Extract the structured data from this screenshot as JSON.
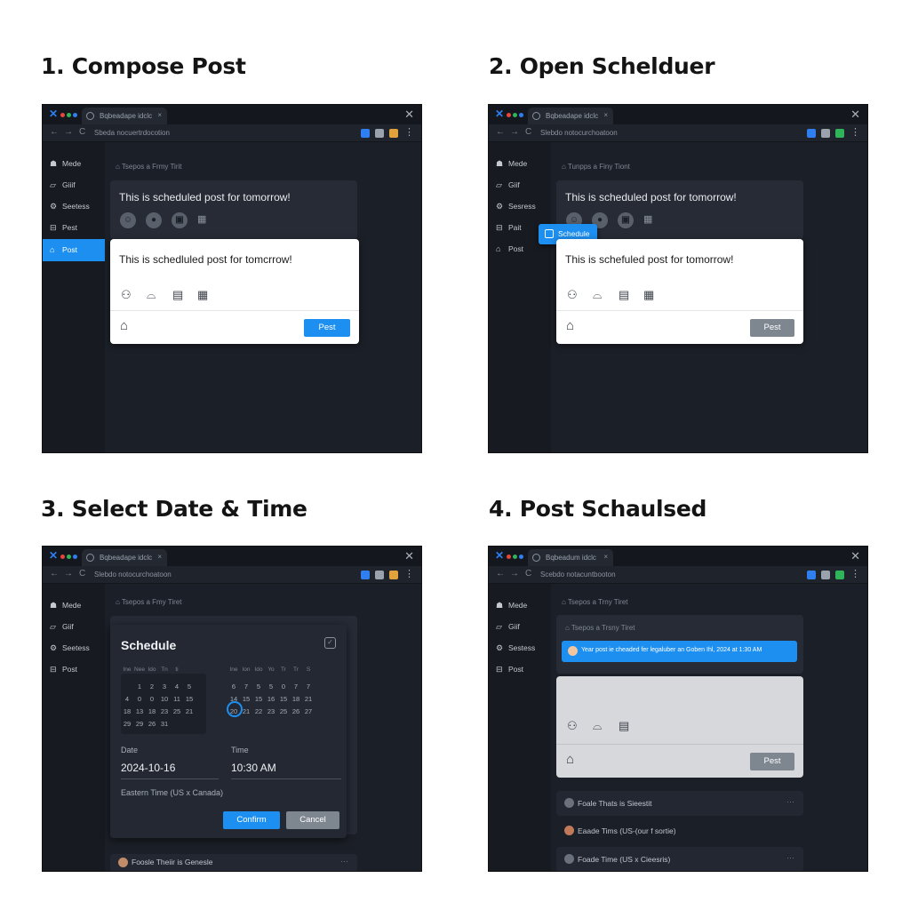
{
  "steps": [
    {
      "title": "1. Compose Post"
    },
    {
      "title": "2. Open Schelduer"
    },
    {
      "title": "3. Select Date & Time"
    },
    {
      "title": "4. Post Schaulsed"
    }
  ],
  "browser": {
    "tab_titles": [
      "Bqbeadape idclc",
      "Bqbeadape idclc",
      "Bqbeadape idclc",
      "Bqbeadum idclc"
    ],
    "url": "Sbeda nocuertrdocotion",
    "url_alt": "Slebdo notocurchoatoon",
    "url_4": "Scebdo notacuntbooton",
    "colors": {
      "accent": "#1d8ff0",
      "dot_red": "#e8453c",
      "dot_green": "#2fb45a",
      "dot_blue": "#2f7ff0"
    }
  },
  "sidebar": {
    "items": [
      {
        "label": "Mede",
        "icon": "home-icon"
      },
      {
        "label": "Giiif",
        "icon": "image-icon"
      },
      {
        "label": "Seetess",
        "icon": "settings-icon"
      },
      {
        "label": "Pest",
        "icon": "lock-icon"
      },
      {
        "label": "Post",
        "icon": "post-icon"
      }
    ],
    "items_2": [
      "Mede",
      "Giif",
      "Sesress",
      "Pait",
      "Post"
    ],
    "items_3": [
      "Mede",
      "Giif",
      "Seetess",
      "Post"
    ],
    "items_4": [
      "Mede",
      "Giif",
      "Sestess",
      "Post"
    ]
  },
  "breadcrumb": "Tsepos a Frmy Tirit",
  "breadcrumb_2": "Tunpps a Finy Tiont",
  "breadcrumb_3": "Tsepos a Fmy Tiret",
  "breadcrumb_4": "Tsepos a Trny Tiret",
  "composer": {
    "text_preview": "This is scheduled post for tomorrow!",
    "text_1": "This is schedluled post for tomcrrow!",
    "text_2": "This is schefuled post for tomorrow!",
    "post_label": "Pest",
    "post_label_disabled": "Pest"
  },
  "schedule_tip": "Schedule",
  "dialog": {
    "title": "Schedule",
    "left_calendar": {
      "header": [
        "Ine",
        "Nee",
        "Ido",
        "Tn",
        "ti"
      ],
      "rows": [
        [
          "",
          "1",
          "2",
          "3",
          "4",
          "5"
        ],
        [
          "4",
          "0",
          "0",
          "10",
          "11",
          "15"
        ],
        [
          "18",
          "13",
          "18",
          "23",
          "25",
          "21"
        ],
        [
          "29",
          "29",
          "26",
          "31",
          "",
          ""
        ]
      ]
    },
    "right_calendar": {
      "header": [
        "Ine",
        "Ion",
        "Ido",
        "Yo",
        "Tr",
        "Tr",
        "S"
      ],
      "rows": [
        [
          "6",
          "7",
          "5",
          "5",
          "0",
          "7",
          "7"
        ],
        [
          "14",
          "15",
          "15",
          "16",
          "15",
          "18",
          "21"
        ],
        [
          "20",
          "21",
          "22",
          "23",
          "25",
          "26",
          "27"
        ]
      ]
    },
    "date_label": "Date",
    "date_value": "2024-10-16",
    "time_label": "Time",
    "time_value": "10:30 AM",
    "timezone": "Eastern Time (US x Canada)",
    "confirm_label": "Confirm",
    "cancel_label": "Cancel",
    "behind_row": "Foosle Theiir is Genesle"
  },
  "toast": {
    "text": "Year post ie cheaded fer legaluber an Goben Ihl, 2024 at 1:30 AM",
    "behind_text": "Tsepos a Trsny Tiret"
  },
  "list_rows": [
    {
      "text": "Foale Thats is Sieestit"
    },
    {
      "text": "Eaade Tims (US-(our f sortie)"
    },
    {
      "text": "Foade Time (US x Cieesris)"
    }
  ],
  "step4_post_label": "Pest"
}
